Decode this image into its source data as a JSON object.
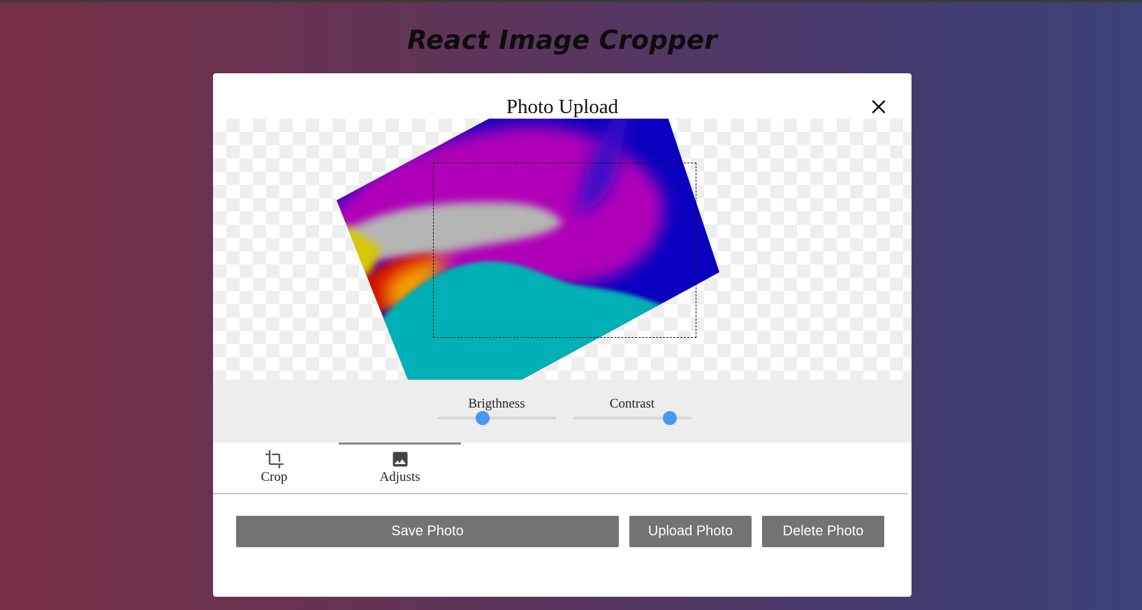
{
  "app": {
    "title": "React Image Cropper"
  },
  "modal": {
    "title": "Photo Upload",
    "close_icon": "close-icon"
  },
  "adjustments": {
    "brightness": {
      "label": "Brigthness",
      "value_fraction": 0.38
    },
    "contrast": {
      "label": "Contrast",
      "value_fraction": 0.82
    }
  },
  "tabs": [
    {
      "label": "Crop",
      "icon": "crop-icon",
      "active": false
    },
    {
      "label": "Adjusts",
      "icon": "image-icon",
      "active": true
    }
  ],
  "buttons": {
    "save": "Save Photo",
    "upload": "Upload Photo",
    "delete": "Delete Photo"
  },
  "colors": {
    "slider_thumb": "#4c95f5",
    "button_bg": "#737373",
    "panel_bg": "#ededed"
  }
}
